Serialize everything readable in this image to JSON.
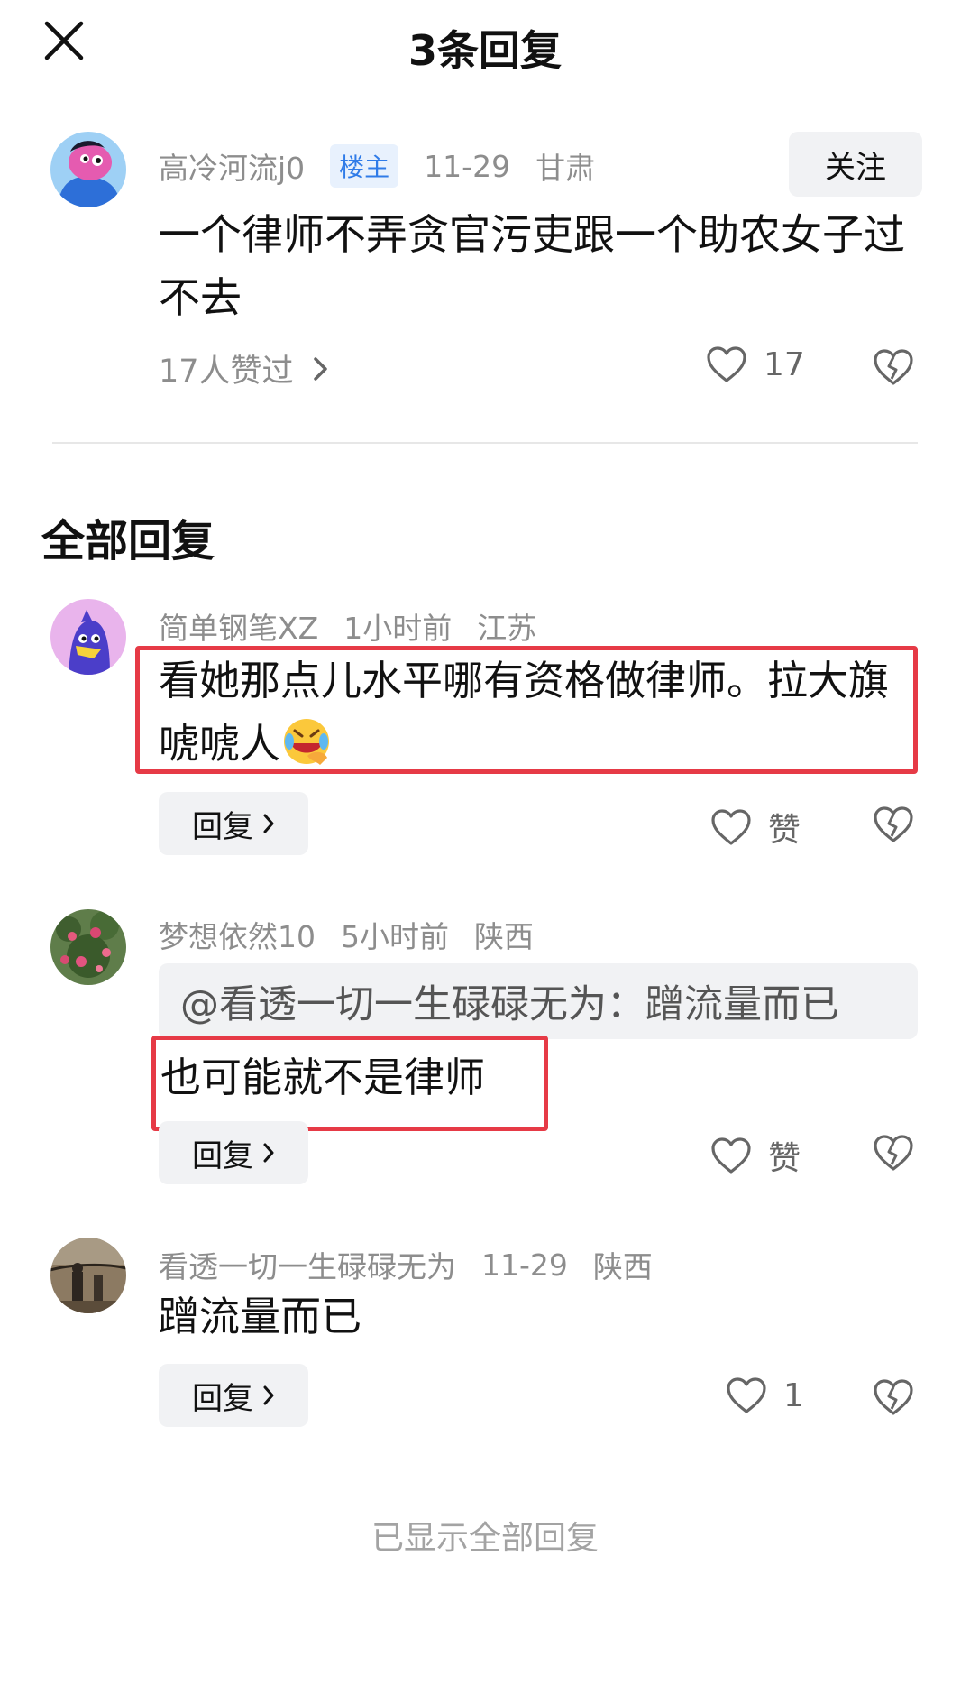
{
  "header": {
    "title": "3条回复"
  },
  "main_comment": {
    "username": "高冷河流j0",
    "badge": "楼主",
    "date": "11-29",
    "location": "甘肃",
    "follow_label": "关注",
    "text": "一个律师不弄贪官污吏跟一个助农女子过不去",
    "likers": "17人赞过",
    "like_count": "17"
  },
  "section_title": "全部回复",
  "replies": [
    {
      "username": "简单钢笔XZ",
      "time": "1小时前",
      "location": "江苏",
      "text": "看她那点儿水平哪有资格做律师。拉大旗唬唬人",
      "reply_label": "回复",
      "like_label": "赞"
    },
    {
      "username": "梦想依然10",
      "time": "5小时前",
      "location": "陕西",
      "quote": "@看透一切一生碌碌无为：蹭流量而已",
      "text": "也可能就不是律师",
      "reply_label": "回复",
      "like_label": "赞"
    },
    {
      "username": "看透一切一生碌碌无为",
      "time": "11-29",
      "location": "陕西",
      "text": "蹭流量而已",
      "reply_label": "回复",
      "like_label": "1"
    }
  ],
  "footer": "已显示全部回复",
  "colors": {
    "highlight": "#e63a46",
    "badge_text": "#2f7be8",
    "badge_bg": "#e8f1fd",
    "meta_text": "#8d8d8d"
  },
  "icons": [
    "close-icon",
    "chevron-right-icon",
    "heart-icon",
    "broken-heart-icon",
    "laughing-emoji-icon"
  ]
}
